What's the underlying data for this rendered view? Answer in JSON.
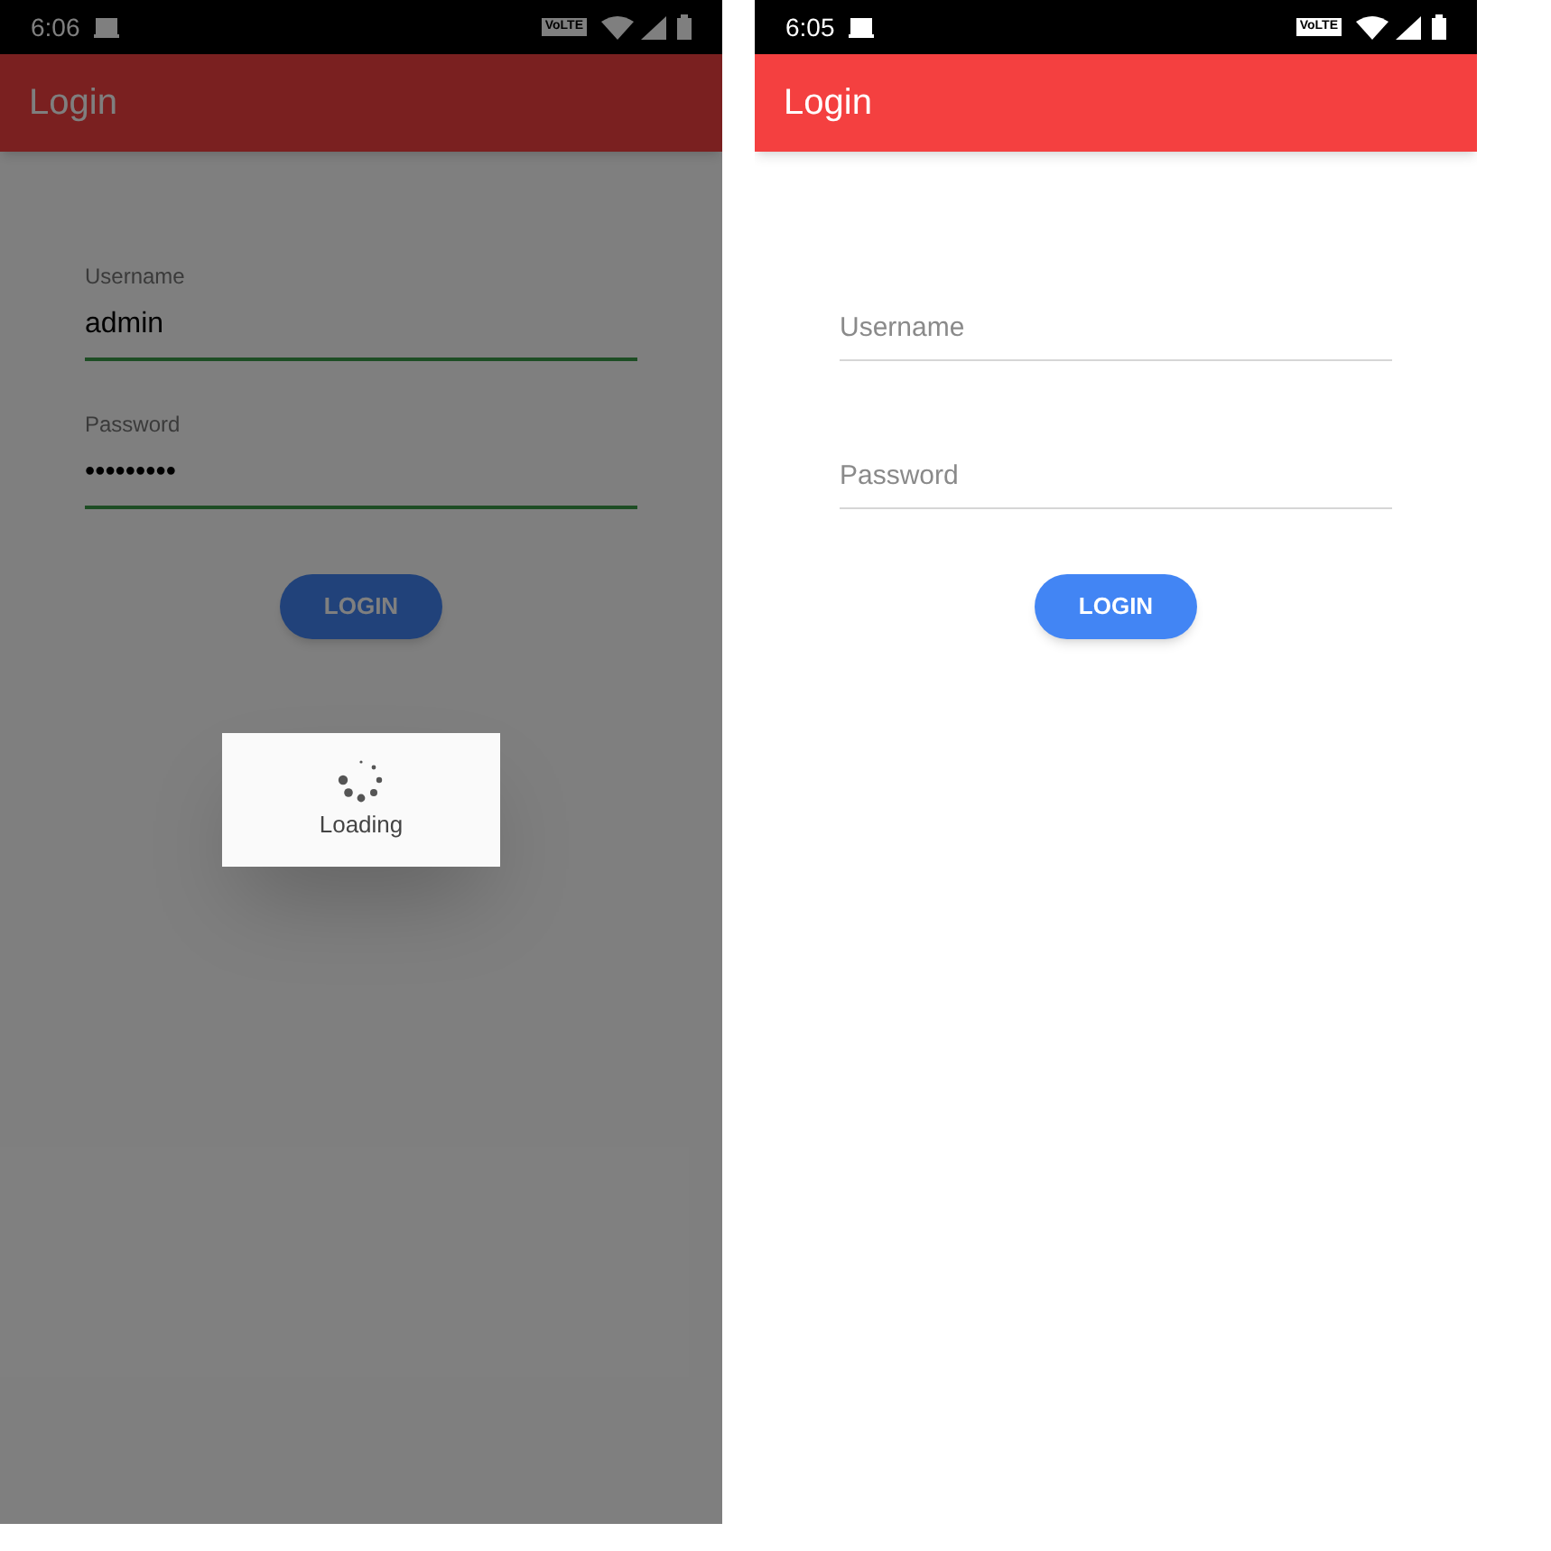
{
  "screens": [
    {
      "status_bar": {
        "time": "6:06",
        "network": "VoLTE"
      },
      "app_bar": {
        "title": "Login"
      },
      "fields": [
        {
          "label": "Username",
          "value": "admin",
          "highlighted": true
        },
        {
          "label": "Password",
          "value": "•••••••••",
          "highlighted": true
        }
      ],
      "button": "LOGIN",
      "dimmed": true,
      "loading_dialog": {
        "text": "Loading"
      }
    },
    {
      "status_bar": {
        "time": "6:05",
        "network": "VoLTE"
      },
      "app_bar": {
        "title": "Login"
      },
      "fields": [
        {
          "placeholder": "Username",
          "highlighted": false
        },
        {
          "placeholder": "Password",
          "highlighted": false
        }
      ],
      "button": "LOGIN",
      "dimmed": false
    }
  ]
}
